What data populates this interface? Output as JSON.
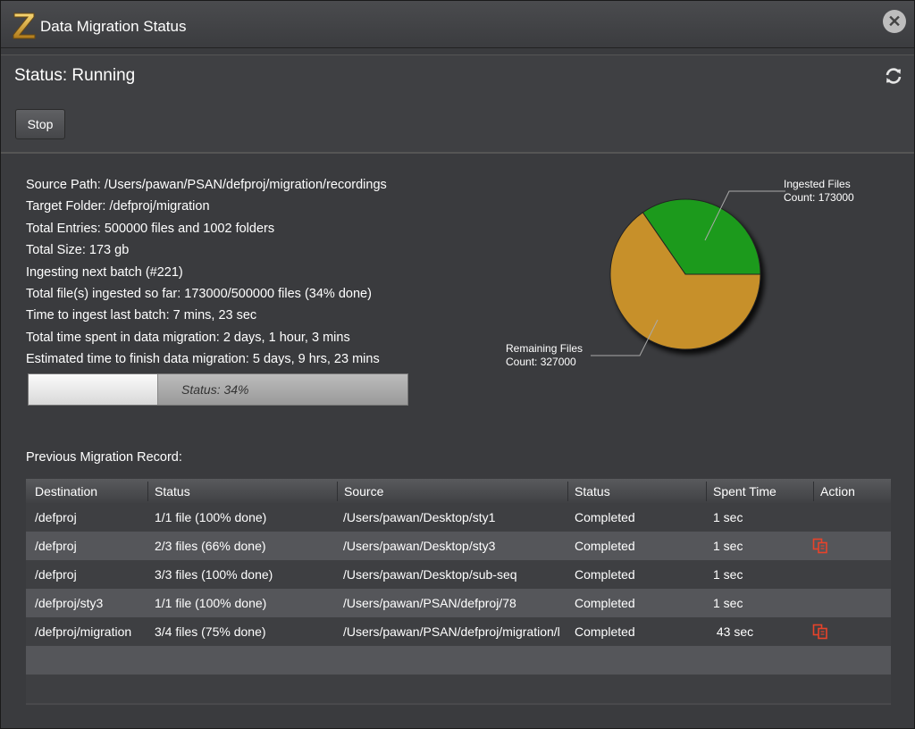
{
  "window": {
    "title": "Data Migration Status",
    "close_label": "✕"
  },
  "status": {
    "title": "Status: Running",
    "stop_label": "Stop"
  },
  "details": [
    "Source Path: /Users/pawan/PSAN/defproj/migration/recordings",
    "Target Folder:  /defproj/migration",
    "Total Entries: 500000 files and 1002 folders",
    "Total Size: 173 gb",
    "Ingesting next batch (#221)",
    "Total file(s) ingested so far: 173000/500000 files (34% done)",
    "Time to ingest last batch: 7 mins, 23 sec",
    "Total time spent in data migration: 2 days, 1 hour, 3 mins",
    "Estimated time to finish data migration: 5 days, 9 hrs, 23 mins"
  ],
  "progress": {
    "label": "Status: 34%",
    "percent": 34
  },
  "chart_data": {
    "type": "pie",
    "slices": [
      {
        "label_line1": "Ingested Files",
        "label_line2": "Count: 173000",
        "value": 173000,
        "color": "#1e9a1e"
      },
      {
        "label_line1": "Remaining Files",
        "label_line2": "Count: 327000",
        "value": 327000,
        "color": "#c7902a"
      }
    ]
  },
  "previous": {
    "label": "Previous Migration Record:",
    "columns": [
      "Destination",
      "Status",
      "Source",
      "Status",
      "Spent Time",
      "Action"
    ],
    "rows": [
      {
        "destination": "/defproj",
        "status": "1/1 file (100% done)",
        "source": "/Users/pawan/Desktop/sty1",
        "result": "Completed",
        "time": "1 sec",
        "action": false
      },
      {
        "destination": "/defproj",
        "status": "2/3 files (66% done)",
        "source": "/Users/pawan/Desktop/sty3",
        "result": "Completed",
        "time": "1 sec",
        "action": true
      },
      {
        "destination": "/defproj",
        "status": "3/3 files (100% done)",
        "source": "/Users/pawan/Desktop/sub-seq",
        "result": "Completed",
        "time": "1 sec",
        "action": false
      },
      {
        "destination": "/defproj/sty3",
        "status": "1/1 file (100% done)",
        "source": "/Users/pawan/PSAN/defproj/78",
        "result": "Completed",
        "time": "1 sec",
        "action": false
      },
      {
        "destination": "/defproj/migration",
        "status": "3/4 files (75% done)",
        "source": "/Users/pawan/PSAN/defproj/migration/l",
        "result": "Completed",
        "time": " 43 sec",
        "action": true
      }
    ]
  },
  "colors": {
    "accent_icon": "#e8432a"
  }
}
